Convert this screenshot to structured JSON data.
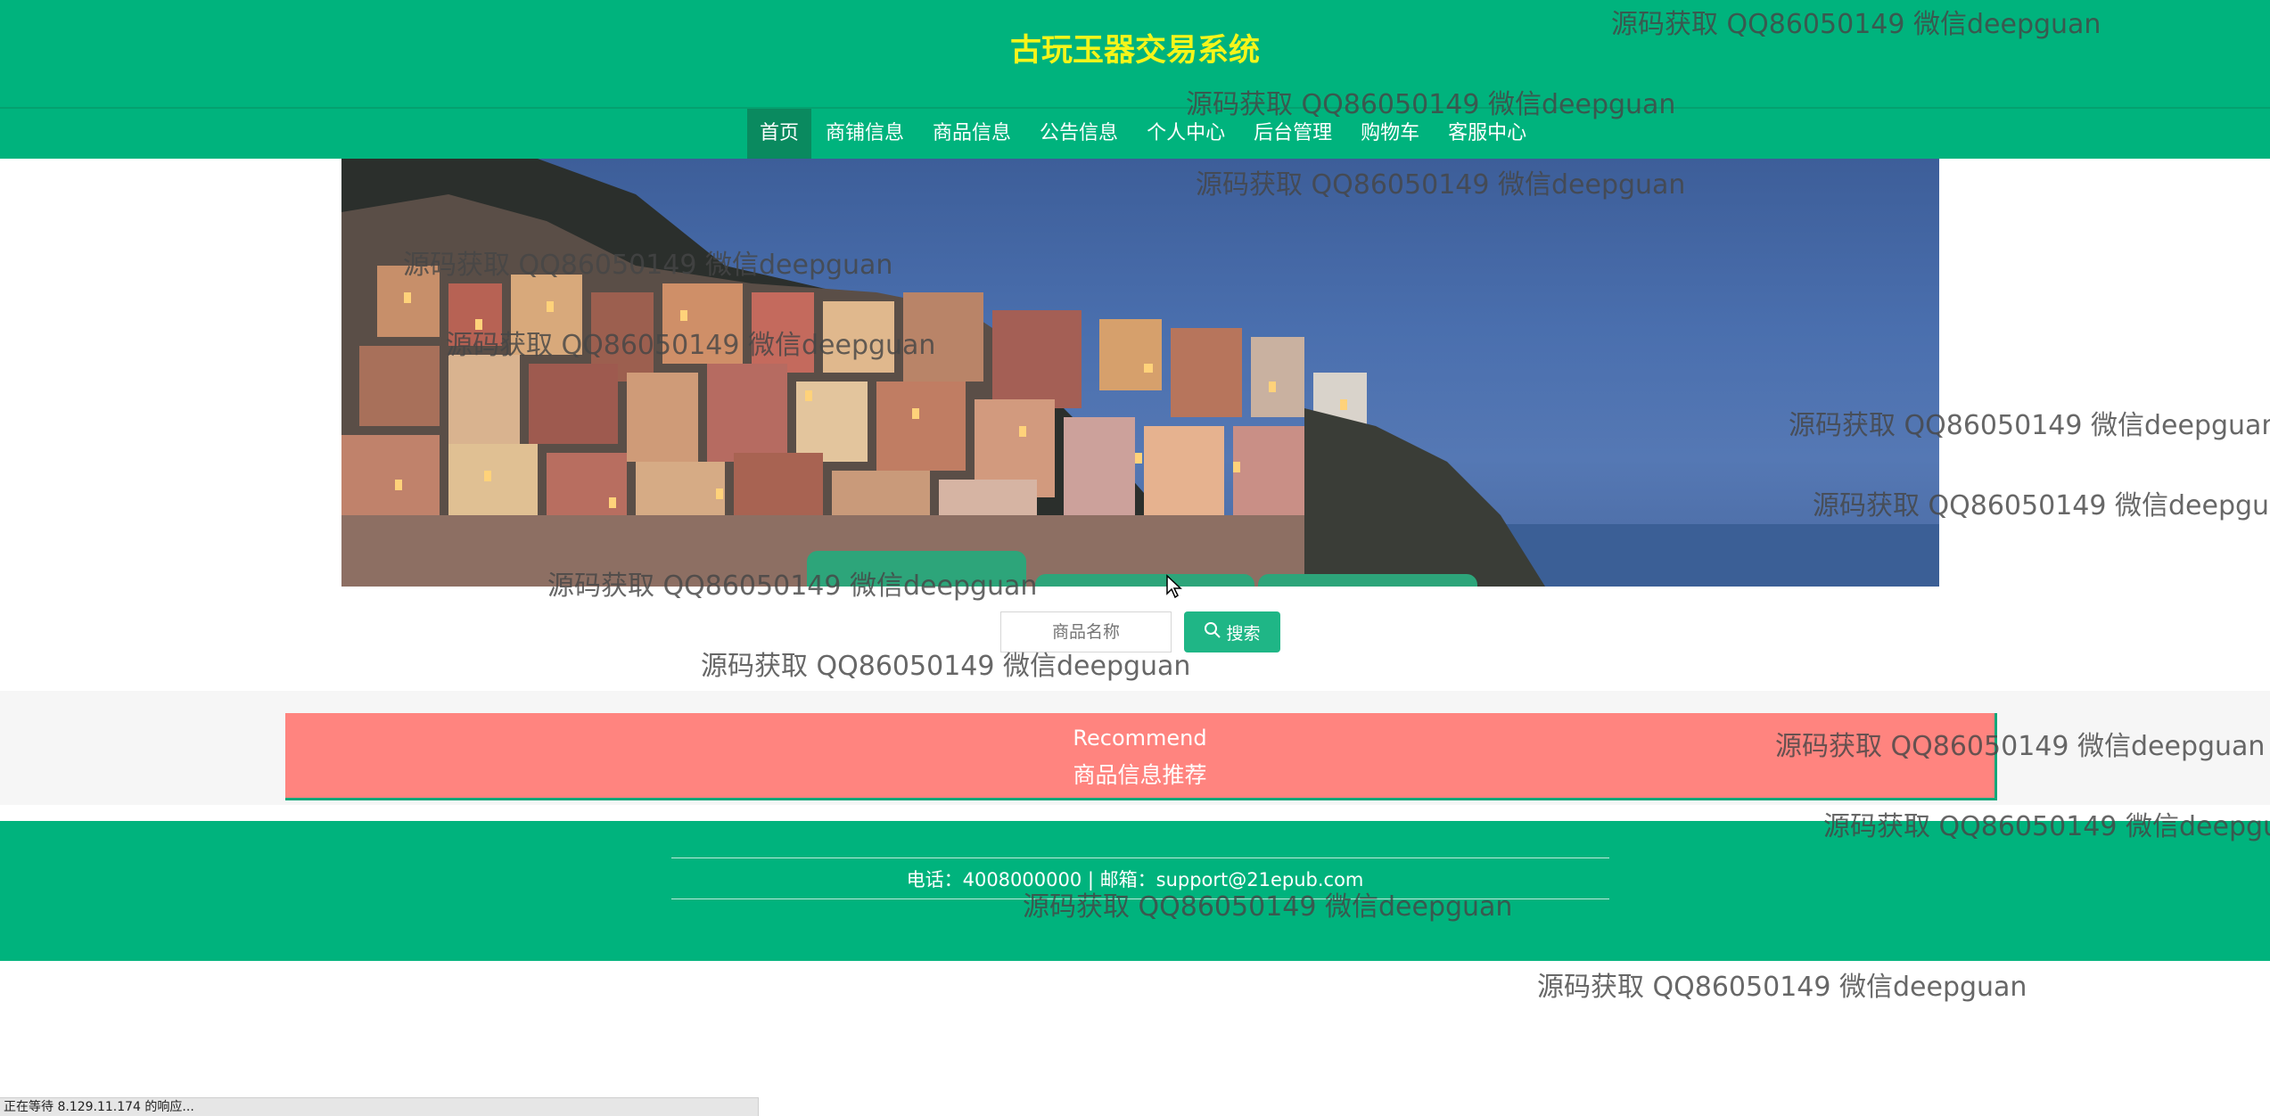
{
  "header": {
    "title": "古玩玉器交易系统"
  },
  "nav": {
    "items": [
      {
        "label": "首页",
        "active": true
      },
      {
        "label": "商铺信息"
      },
      {
        "label": "商品信息"
      },
      {
        "label": "公告信息"
      },
      {
        "label": "个人中心"
      },
      {
        "label": "后台管理"
      },
      {
        "label": "购物车"
      },
      {
        "label": "客服中心"
      }
    ]
  },
  "search": {
    "placeholder": "商品名称",
    "button_label": "搜索",
    "icon": "search-icon"
  },
  "recommend": {
    "title_en": "Recommend",
    "title_cn": "商品信息推荐"
  },
  "footer": {
    "contact": "电话：4008000000 | 邮箱：support@21epub.com"
  },
  "status_bar": {
    "text": "正在等待 8.129.11.174 的响应..."
  },
  "watermark": {
    "text": "源码获取 QQ86050149 微信deepguan"
  },
  "colors": {
    "primary": "#00b37d",
    "title": "#f5f51a",
    "recommend": "#ff847f",
    "active_nav": "#0a8a5f"
  }
}
